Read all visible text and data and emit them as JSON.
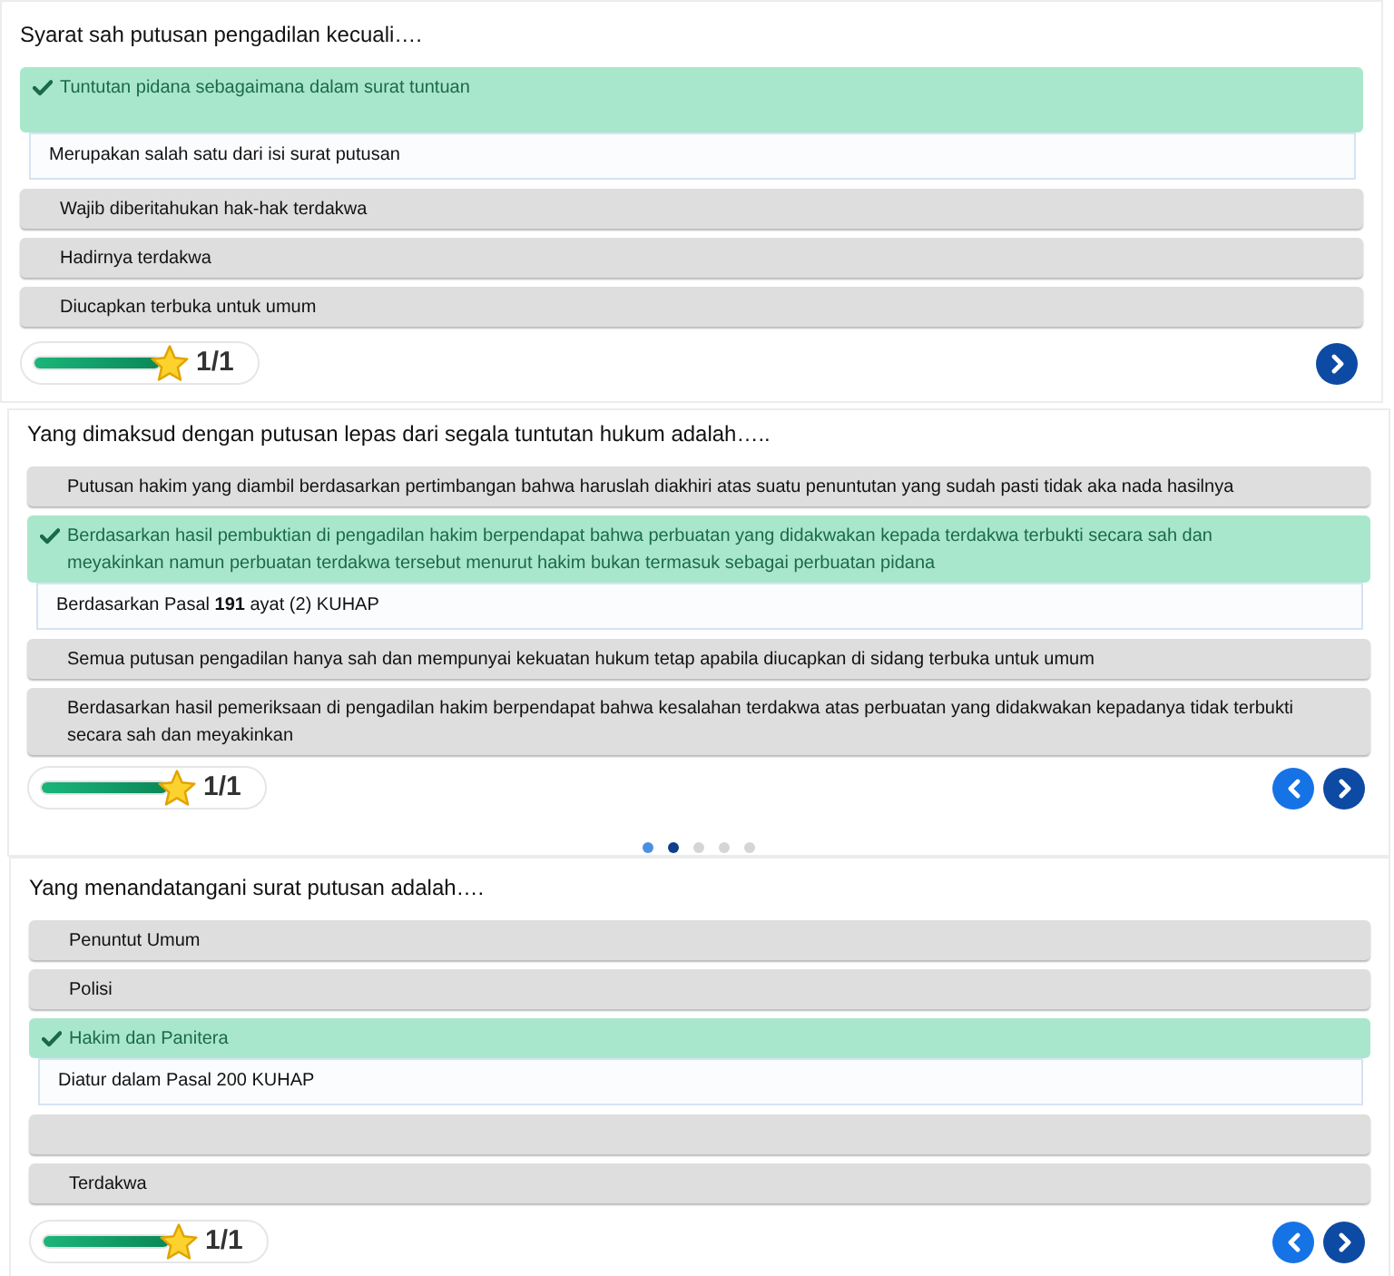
{
  "cards": [
    {
      "question": "Syarat sah putusan pengadilan kecuali….",
      "options": [
        {
          "text": "Tuntutan pidana sebagaimana dalam surat tuntuan",
          "correct": true,
          "explanation": "Merupakan salah satu dari isi surat putusan"
        },
        {
          "text": "Wajib diberitahukan hak-hak terdakwa",
          "correct": false
        },
        {
          "text": "Hadirnya terdakwa",
          "correct": false
        },
        {
          "text": "Diucapkan terbuka untuk umum",
          "correct": false
        }
      ],
      "progress": {
        "level": 1,
        "score": "1/1"
      },
      "nav_buttons": [
        {
          "kind": "next"
        }
      ]
    },
    {
      "question": "Yang dimaksud dengan putusan lepas dari segala tuntutan hukum adalah…..",
      "options": [
        {
          "text": "Putusan hakim yang diambil berdasarkan pertimbangan bahwa haruslah diakhiri atas suatu penuntutan yang sudah pasti tidak aka nada hasilnya",
          "correct": false
        },
        {
          "text": "Berdasarkan hasil pembuktian di pengadilan hakim berpendapat bahwa perbuatan yang didakwakan kepada terdakwa terbukti secara sah dan meyakinkan namun perbuatan terdakwa tersebut menurut hakim bukan termasuk sebagai perbuatan pidana",
          "correct": true,
          "explanation": "Berdasarkan Pasal **191** ayat (2) KUHAP"
        },
        {
          "text": "Semua putusan pengadilan hanya sah dan mempunyai kekuatan hukum tetap apabila diucapkan di sidang terbuka untuk umum",
          "correct": false
        },
        {
          "text": "Berdasarkan hasil pemeriksaan di pengadilan hakim berpendapat bahwa kesalahan terdakwa atas perbuatan yang didakwakan kepadanya tidak terbukti secara sah dan meyakinkan",
          "correct": false
        }
      ],
      "progress": {
        "level": 1,
        "score": "1/1"
      },
      "nav_buttons": [
        {
          "kind": "previous"
        },
        {
          "kind": "next"
        }
      ],
      "pager": [
        {
          "selected": false,
          "answered": true
        },
        {
          "selected": true,
          "answered": true
        },
        {
          "selected": false,
          "answered": false
        },
        {
          "selected": false,
          "answered": false
        },
        {
          "selected": false,
          "answered": false
        }
      ]
    },
    {
      "question": "Yang menandatangani surat putusan adalah….",
      "options": [
        {
          "text": "Penuntut Umum",
          "correct": false
        },
        {
          "text": "Polisi",
          "correct": false
        },
        {
          "text": "Hakim dan Panitera",
          "correct": true,
          "explanation": "Diatur dalam Pasal 200 KUHAP"
        },
        {
          "correct": false
        },
        {
          "text": "Terdakwa",
          "correct": false
        }
      ],
      "progress": {
        "level": 1,
        "score": "1/1"
      },
      "nav_buttons": [
        {
          "kind": "previous"
        },
        {
          "kind": "next"
        }
      ]
    }
  ]
}
